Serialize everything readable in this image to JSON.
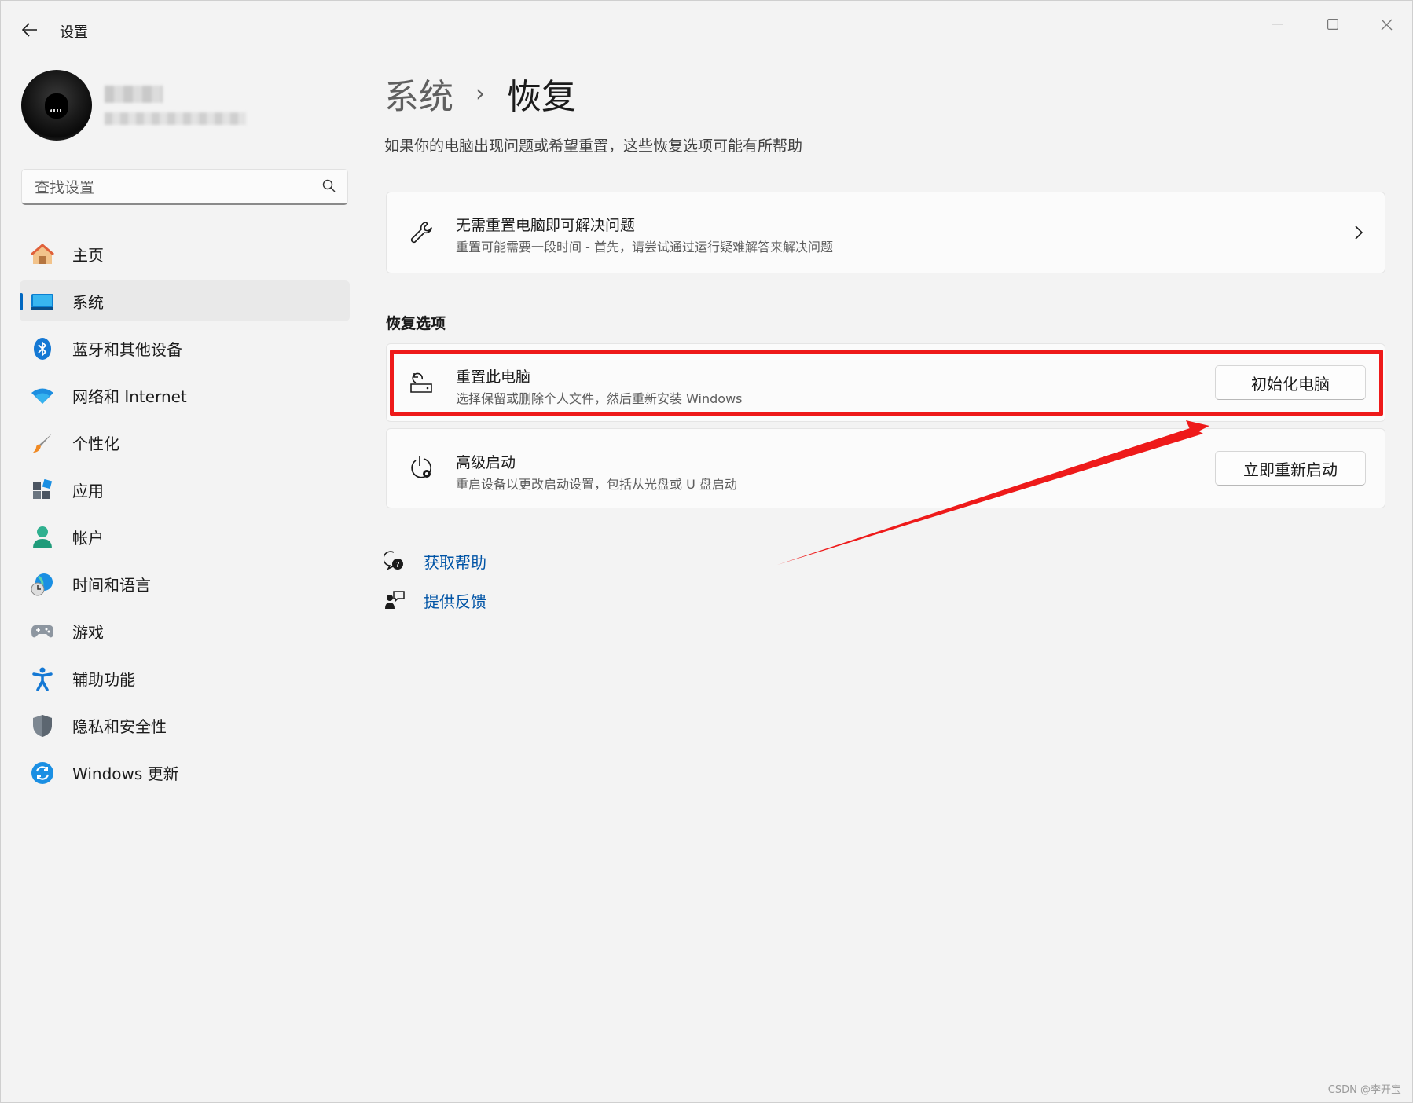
{
  "window": {
    "app_title": "设置",
    "controls": {
      "minimize": "minimize",
      "maximize": "maximize",
      "close": "close"
    }
  },
  "search": {
    "placeholder": "查找设置"
  },
  "sidebar": {
    "items": [
      {
        "label": "主页",
        "icon": "home-icon",
        "active": false
      },
      {
        "label": "系统",
        "icon": "system-display-icon",
        "active": true
      },
      {
        "label": "蓝牙和其他设备",
        "icon": "bluetooth-icon",
        "active": false
      },
      {
        "label": "网络和 Internet",
        "icon": "wifi-icon",
        "active": false
      },
      {
        "label": "个性化",
        "icon": "paintbrush-icon",
        "active": false
      },
      {
        "label": "应用",
        "icon": "apps-icon",
        "active": false
      },
      {
        "label": "帐户",
        "icon": "account-icon",
        "active": false
      },
      {
        "label": "时间和语言",
        "icon": "time-language-icon",
        "active": false
      },
      {
        "label": "游戏",
        "icon": "gamepad-icon",
        "active": false
      },
      {
        "label": "辅助功能",
        "icon": "accessibility-icon",
        "active": false
      },
      {
        "label": "隐私和安全性",
        "icon": "shield-icon",
        "active": false
      },
      {
        "label": "Windows 更新",
        "icon": "windows-update-icon",
        "active": false
      }
    ]
  },
  "main": {
    "breadcrumb": {
      "parent": "系统",
      "separator": "›",
      "current": "恢复"
    },
    "description": "如果你的电脑出现问题或希望重置，这些恢复选项可能有所帮助",
    "troubleshoot_card": {
      "title": "无需重置电脑即可解决问题",
      "subtitle": "重置可能需要一段时间 - 首先，请尝试通过运行疑难解答来解决问题"
    },
    "section_title": "恢复选项",
    "reset_card": {
      "title": "重置此电脑",
      "subtitle": "选择保留或删除个人文件，然后重新安装 Windows",
      "button": "初始化电脑"
    },
    "advanced_card": {
      "title": "高级启动",
      "subtitle": "重启设备以更改启动设置，包括从光盘或 U 盘启动",
      "button": "立即重新启动"
    },
    "links": [
      {
        "label": "获取帮助",
        "icon": "get-help-icon"
      },
      {
        "label": "提供反馈",
        "icon": "feedback-icon"
      }
    ]
  },
  "annotation": {
    "color": "#ee1a1a"
  },
  "watermark": "CSDN @李开宝",
  "colors": {
    "accent": "#0067c0",
    "link": "#0054a6",
    "annotation_red": "#ee1a1a"
  }
}
